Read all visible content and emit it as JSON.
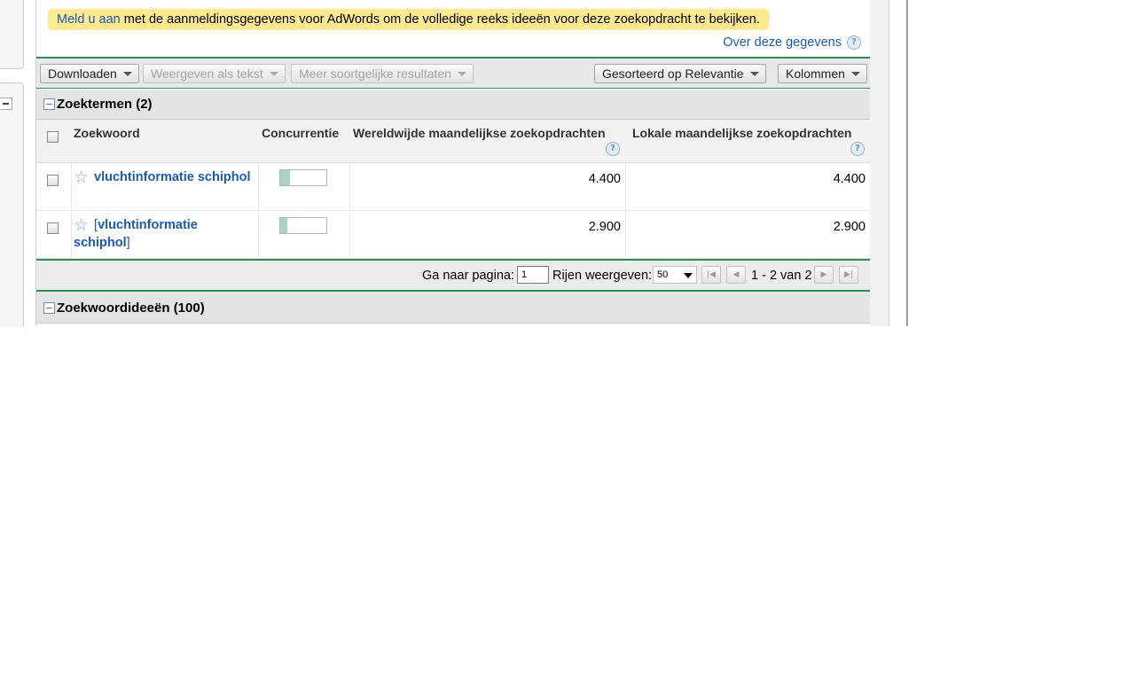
{
  "notice": {
    "link_text": "Meld u aan",
    "text": " met de aanmeldingsgegevens voor AdWords om de volledige reeks ideeën voor deze zoekopdracht te bekijken."
  },
  "about_link": "Over deze gegevens",
  "toolbar": {
    "download": "Downloaden",
    "show_as_text": "Weergeven als tekst",
    "more_similar": "Meer soortgelijke resultaten",
    "sorted_by": "Gesorteerd op Relevantie",
    "columns": "Kolommen"
  },
  "search_terms": {
    "title": "Zoektermen (2)",
    "headers": {
      "keyword": "Zoekwoord",
      "competition": "Concurrentie",
      "global_monthly": "Wereldwijde maandelijkse zoekopdrachten",
      "local_monthly": "Lokale maandelijkse zoekopdrachten"
    },
    "rows": [
      {
        "prefix": "",
        "keyword": "vluchtinformatie schiphol",
        "suffix": "",
        "competition": 0.22,
        "global": "4.400",
        "local": "4.400"
      },
      {
        "prefix": "[",
        "keyword": "vluchtinformatie schiphol",
        "suffix": "]",
        "competition": 0.15,
        "global": "2.900",
        "local": "2.900"
      }
    ]
  },
  "pager": {
    "goto_label": "Ga naar pagina:",
    "page_value": "1",
    "rows_label": "Rijen weergeven:",
    "rows_value": "50",
    "range": "1 - 2 van 2"
  },
  "keyword_ideas": {
    "title": "Zoekwoordideeën (100)"
  },
  "colors": {
    "link": "#1a5ab8",
    "notice_bg": "#fde98f",
    "section_rule": "#2e8b57",
    "competition_fill": "#a6d6c3"
  }
}
